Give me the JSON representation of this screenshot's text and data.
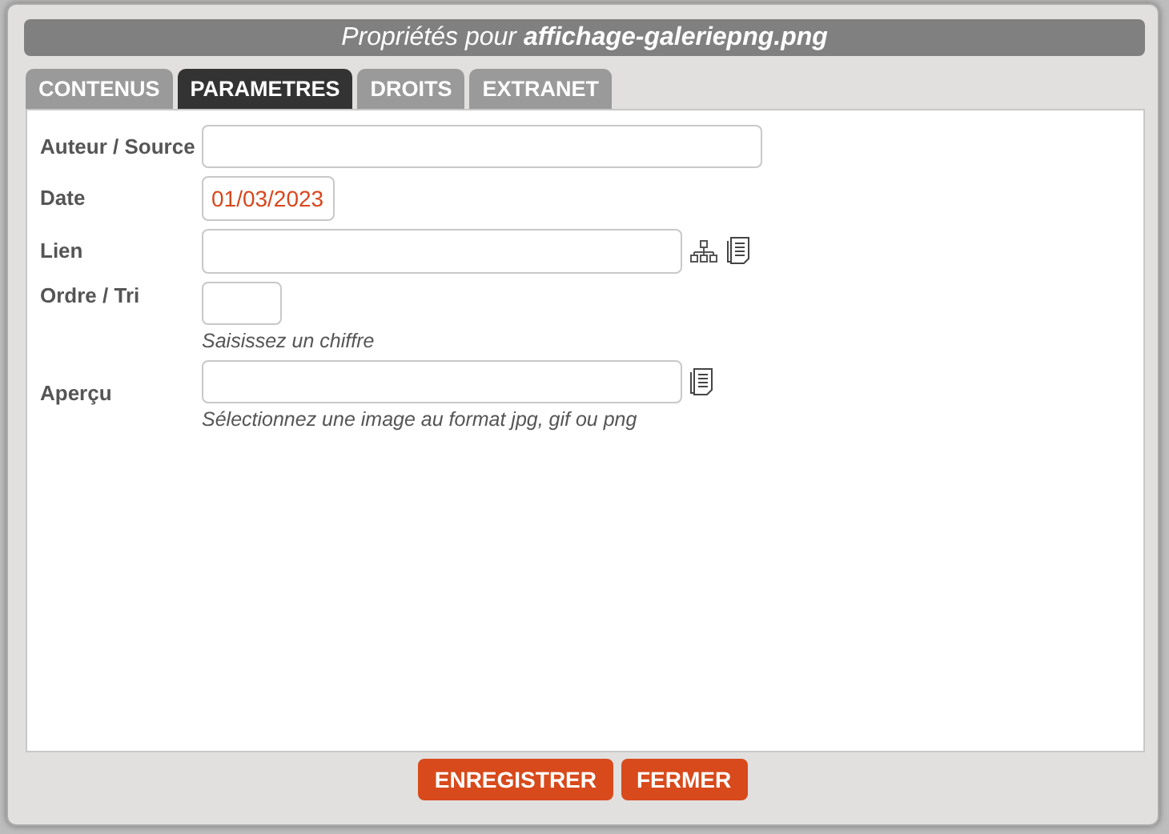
{
  "dialog": {
    "title": "Propriétés pour **affichage-galeriepng.png**"
  },
  "tabs": [
    {
      "label": "CONTENUS",
      "selected": false
    },
    {
      "label": "PARAMETRES",
      "selected": true
    },
    {
      "label": "DROITS",
      "selected": false
    },
    {
      "label": "EXTRANET",
      "selected": false
    }
  ],
  "fields": [
    {
      "kind": "text",
      "label": "Auteur / Source"
    },
    {
      "kind": "date",
      "label": "Date",
      "value": "01/03/2023"
    },
    {
      "kind": "link",
      "label": "Lien"
    },
    {
      "kind": "number",
      "label": "Ordre / Tri",
      "hint": "Saisissez un chiffre"
    },
    {
      "kind": "image",
      "label": "Aperçu",
      "hint": "Sélectionnez une image au format jpg, gif ou png"
    }
  ],
  "buttons": [
    "ENREGISTRER",
    "FERMER"
  ]
}
